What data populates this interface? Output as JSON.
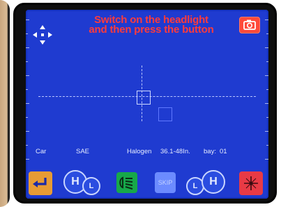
{
  "screen": {
    "instruction_line1": "Switch on the headlight",
    "instruction_line2": "and then press the button",
    "info": {
      "vehicle": "Car",
      "standard": "SAE",
      "lamp_type": "Halogen",
      "height_range": "36.1-48In.",
      "bay_label": "bay:",
      "bay_value": "01"
    },
    "buttons": {
      "skip_label": "SKIP",
      "high_beam_label": "H",
      "low_beam_label": "L",
      "low_beam_label_2": "L",
      "high_beam_label_2": "H"
    },
    "icons": {
      "nav": "four-direction-arrows-icon",
      "camera": "camera-icon",
      "back": "back-arrow-icon",
      "headlight": "headlight-icon",
      "laser": "laser-crosshair-icon"
    },
    "colors": {
      "screen_bg": "#1f3bd0",
      "instruction_text": "#ff3b3b",
      "back_button": "#e79b34",
      "headlight_button": "#17a84a",
      "skip_button": "#6c8bff",
      "laser_button": "#e83a45",
      "camera_button": "#ff4a3a"
    }
  }
}
